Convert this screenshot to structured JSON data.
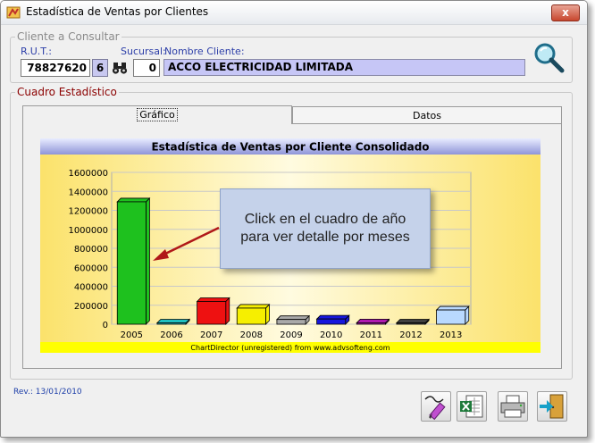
{
  "window": {
    "title": "Estadística de Ventas por Clientes",
    "close_label": "x"
  },
  "cliente": {
    "legend": "Cliente a Consultar",
    "rut_label": "R.U.T.:",
    "rut_value": "78827620",
    "rut_dv": "6",
    "sucursal_label": "Sucursal:",
    "sucursal_value": "0",
    "nombre_label": "Nombre Cliente:",
    "nombre_value": "ACCO ELECTRICIDAD LIMITADA"
  },
  "cuadro": {
    "legend": "Cuadro Estadístico",
    "tabs": [
      {
        "label": "Gráfico"
      },
      {
        "label": "Datos"
      }
    ]
  },
  "chart_data": {
    "type": "bar",
    "title": "Estadística de Ventas por Cliente Consolidado",
    "categories": [
      "2005",
      "2006",
      "2007",
      "2008",
      "2009",
      "2010",
      "2011",
      "2012",
      "2013"
    ],
    "values": [
      1290000,
      10000,
      240000,
      170000,
      50000,
      55000,
      15000,
      10000,
      150000
    ],
    "colors": [
      "#1ec11e",
      "#20c0c0",
      "#ee1111",
      "#f6ef00",
      "#a9a9a9",
      "#1616dd",
      "#b019b0",
      "#404040",
      "#b9d9ff"
    ],
    "ylim": [
      0,
      1600000
    ],
    "yticks": [
      "0",
      "200000",
      "400000",
      "600000",
      "800000",
      "1000000",
      "1200000",
      "1400000",
      "1600000"
    ],
    "footer": "ChartDirector (unregistered) from www.advsofteng.com",
    "annotation": "Click en el cuadro de año para ver detalle por meses"
  },
  "footer": {
    "revision": "Rev.: 13/01/2010"
  }
}
